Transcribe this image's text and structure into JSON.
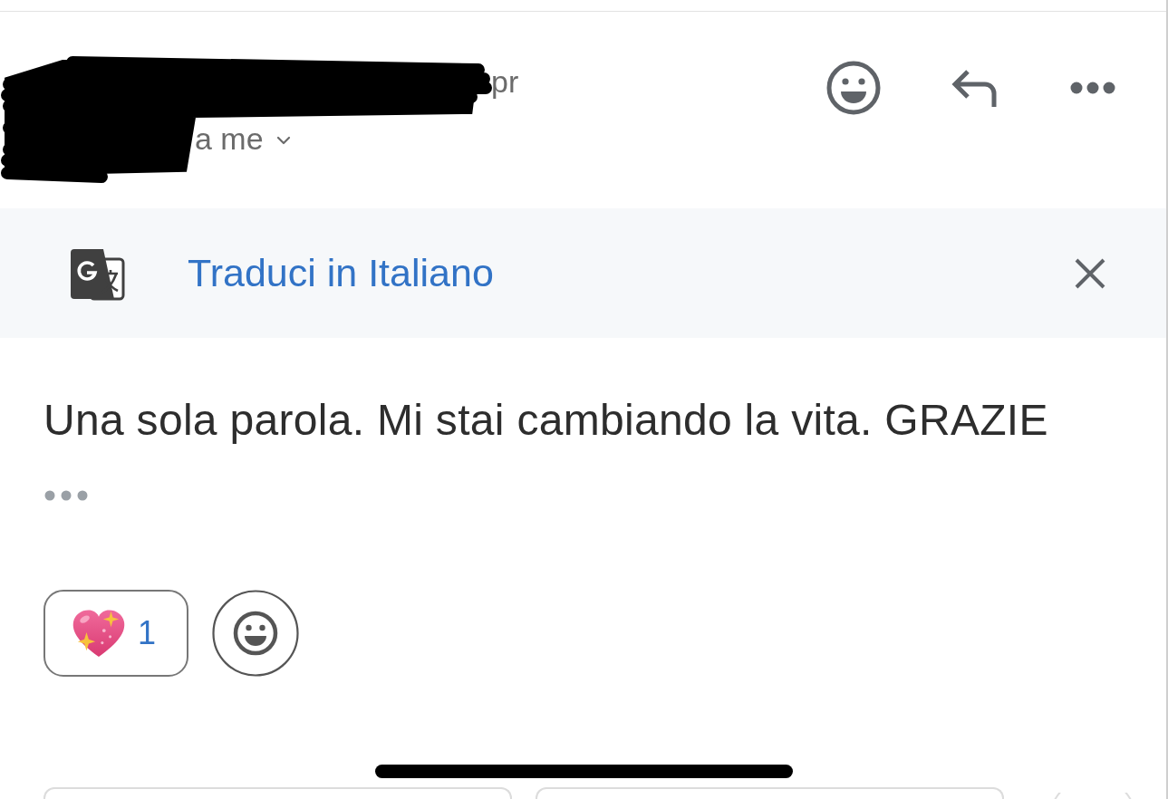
{
  "sender": {
    "name_visible": "pr",
    "recipient": "a me"
  },
  "translate_bar": {
    "label": "Traduci in Italiano"
  },
  "message": {
    "body": "Una sola parola. Mi stai cambiando la vita. GRAZIE"
  },
  "reactions": [
    {
      "count": "1"
    }
  ]
}
